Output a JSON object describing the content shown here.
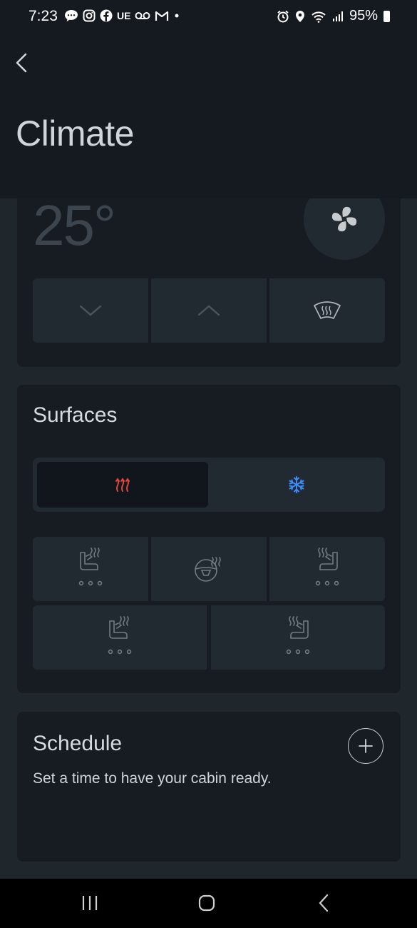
{
  "status_bar": {
    "time": "7:23",
    "left_icons": [
      "chat-icon",
      "instagram-icon",
      "facebook-icon",
      "ue-icon",
      "voicemail-icon",
      "gmail-icon",
      "dot-icon"
    ],
    "ue_label": "UE",
    "right_icons": [
      "alarm-icon",
      "location-icon",
      "wifi-icon",
      "signal-icon",
      "battery-icon"
    ],
    "battery_percent": "95%"
  },
  "header": {
    "title": "Climate",
    "back_icon": "chevron-left-icon"
  },
  "climate_card": {
    "temperature": "25°",
    "fan_icon": "fan-icon",
    "buttons": [
      "temperature-down",
      "temperature-up",
      "defrost"
    ]
  },
  "surfaces": {
    "title": "Surfaces",
    "modes": [
      "heat",
      "cool"
    ],
    "active_mode": "heat",
    "heat_color": "#e0473a",
    "cool_color": "#3d8af7",
    "seats": [
      "driver-seat",
      "steering-wheel",
      "passenger-seat",
      "rear-left-seat",
      "rear-right-seat"
    ]
  },
  "schedule": {
    "title": "Schedule",
    "subtitle": "Set a time to have your cabin ready."
  },
  "nav_bar": {
    "buttons": [
      "recent-apps",
      "home",
      "back"
    ]
  }
}
